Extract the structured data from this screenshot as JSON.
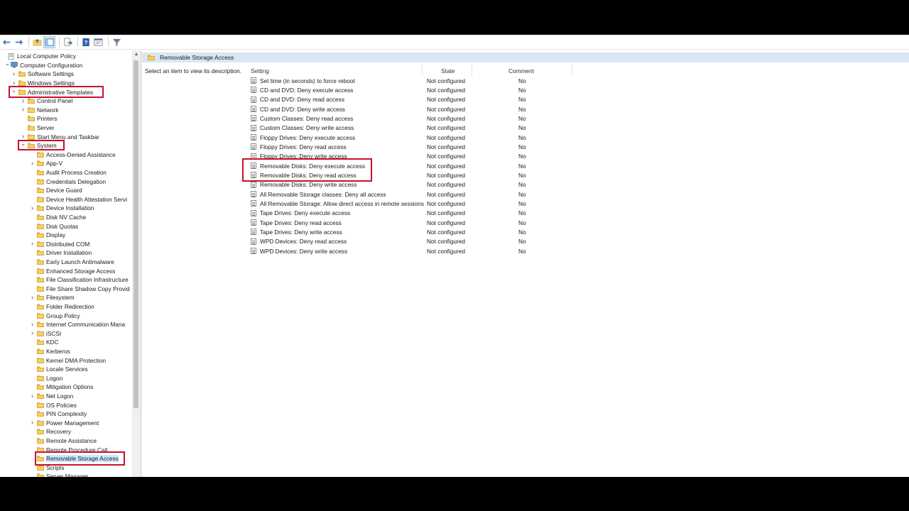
{
  "toolbar": {
    "buttons": [
      "back-icon",
      "forward-icon",
      "up-folder-icon",
      "show-hide-tree-icon",
      "export-list-icon",
      "help-icon",
      "properties-icon",
      "filter-icon"
    ]
  },
  "tree": {
    "items": [
      {
        "label": "Local Computer Policy",
        "level": 0,
        "twisty": ""
      },
      {
        "label": "Computer Configuration",
        "level": 1,
        "twisty": "v"
      },
      {
        "label": "Software Settings",
        "level": 2,
        "twisty": ">"
      },
      {
        "label": "Windows Settings",
        "level": 2,
        "twisty": ">"
      },
      {
        "label": "Administrative Templates",
        "level": 2,
        "twisty": "v"
      },
      {
        "label": "Control Panel",
        "level": 3,
        "twisty": ">"
      },
      {
        "label": "Network",
        "level": 3,
        "twisty": ">"
      },
      {
        "label": "Printers",
        "level": 3,
        "twisty": ""
      },
      {
        "label": "Server",
        "level": 3,
        "twisty": ""
      },
      {
        "label": "Start Menu and Taskbar",
        "level": 3,
        "twisty": ">"
      },
      {
        "label": "System",
        "level": 3,
        "twisty": "v"
      },
      {
        "label": "Access-Denied Assistance",
        "level": 4,
        "twisty": ""
      },
      {
        "label": "App-V",
        "level": 4,
        "twisty": ">"
      },
      {
        "label": "Audit Process Creation",
        "level": 4,
        "twisty": ""
      },
      {
        "label": "Credentials Delegation",
        "level": 4,
        "twisty": ""
      },
      {
        "label": "Device Guard",
        "level": 4,
        "twisty": ""
      },
      {
        "label": "Device Health Attestation Servi",
        "level": 4,
        "twisty": ""
      },
      {
        "label": "Device Installation",
        "level": 4,
        "twisty": ">"
      },
      {
        "label": "Disk NV Cache",
        "level": 4,
        "twisty": ""
      },
      {
        "label": "Disk Quotas",
        "level": 4,
        "twisty": ""
      },
      {
        "label": "Display",
        "level": 4,
        "twisty": ""
      },
      {
        "label": "Distributed COM",
        "level": 4,
        "twisty": ">"
      },
      {
        "label": "Driver Installation",
        "level": 4,
        "twisty": ""
      },
      {
        "label": "Early Launch Antimalware",
        "level": 4,
        "twisty": ""
      },
      {
        "label": "Enhanced Storage Access",
        "level": 4,
        "twisty": ""
      },
      {
        "label": "File Classification Infrastructure",
        "level": 4,
        "twisty": ""
      },
      {
        "label": "File Share Shadow Copy Provid",
        "level": 4,
        "twisty": ""
      },
      {
        "label": "Filesystem",
        "level": 4,
        "twisty": ">"
      },
      {
        "label": "Folder Redirection",
        "level": 4,
        "twisty": ""
      },
      {
        "label": "Group Policy",
        "level": 4,
        "twisty": ""
      },
      {
        "label": "Internet Communication Mana",
        "level": 4,
        "twisty": ">"
      },
      {
        "label": "iSCSI",
        "level": 4,
        "twisty": ">"
      },
      {
        "label": "KDC",
        "level": 4,
        "twisty": ""
      },
      {
        "label": "Kerberos",
        "level": 4,
        "twisty": ""
      },
      {
        "label": "Kernel DMA Protection",
        "level": 4,
        "twisty": ""
      },
      {
        "label": "Locale Services",
        "level": 4,
        "twisty": ""
      },
      {
        "label": "Logon",
        "level": 4,
        "twisty": ""
      },
      {
        "label": "Mitigation Options",
        "level": 4,
        "twisty": ""
      },
      {
        "label": "Net Logon",
        "level": 4,
        "twisty": ">"
      },
      {
        "label": "OS Policies",
        "level": 4,
        "twisty": ""
      },
      {
        "label": "PIN Complexity",
        "level": 4,
        "twisty": ""
      },
      {
        "label": "Power Management",
        "level": 4,
        "twisty": ">"
      },
      {
        "label": "Recovery",
        "level": 4,
        "twisty": ""
      },
      {
        "label": "Remote Assistance",
        "level": 4,
        "twisty": ""
      },
      {
        "label": "Remote Procedure Call",
        "level": 4,
        "twisty": ""
      },
      {
        "label": "Removable Storage Access",
        "level": 4,
        "twisty": "",
        "selected": true
      },
      {
        "label": "Scripts",
        "level": 4,
        "twisty": ""
      },
      {
        "label": "Server Manager",
        "level": 4,
        "twisty": ""
      }
    ]
  },
  "details": {
    "title": "Removable Storage Access",
    "description": "Select an item to view its description.",
    "columns": [
      "Setting",
      "State",
      "Comment"
    ],
    "rows": [
      {
        "setting": "Set time (in seconds) to force reboot",
        "state": "Not configured",
        "comment": "No"
      },
      {
        "setting": "CD and DVD: Deny execute access",
        "state": "Not configured",
        "comment": "No"
      },
      {
        "setting": "CD and DVD: Deny read access",
        "state": "Not configured",
        "comment": "No"
      },
      {
        "setting": "CD and DVD: Deny write access",
        "state": "Not configured",
        "comment": "No"
      },
      {
        "setting": "Custom Classes: Deny read access",
        "state": "Not configured",
        "comment": "No"
      },
      {
        "setting": "Custom Classes: Deny write access",
        "state": "Not configured",
        "comment": "No"
      },
      {
        "setting": "Floppy Drives: Deny execute access",
        "state": "Not configured",
        "comment": "No"
      },
      {
        "setting": "Floppy Drives: Deny read access",
        "state": "Not configured",
        "comment": "No"
      },
      {
        "setting": "Floppy Drives: Deny write access",
        "state": "Not configured",
        "comment": "No"
      },
      {
        "setting": "Removable Disks: Deny execute access",
        "state": "Not configured",
        "comment": "No"
      },
      {
        "setting": "Removable Disks: Deny read access",
        "state": "Not configured",
        "comment": "No"
      },
      {
        "setting": "Removable Disks: Deny write access",
        "state": "Not configured",
        "comment": "No"
      },
      {
        "setting": "All Removable Storage classes: Deny all access",
        "state": "Not configured",
        "comment": "No"
      },
      {
        "setting": "All Removable Storage: Allow direct access in remote sessions",
        "state": "Not configured",
        "comment": "No"
      },
      {
        "setting": "Tape Drives: Deny execute access",
        "state": "Not configured",
        "comment": "No"
      },
      {
        "setting": "Tape Drives: Deny read access",
        "state": "Not configured",
        "comment": "No"
      },
      {
        "setting": "Tape Drives: Deny write access",
        "state": "Not configured",
        "comment": "No"
      },
      {
        "setting": "WPD Devices: Deny read access",
        "state": "Not configured",
        "comment": "No"
      },
      {
        "setting": "WPD Devices: Deny write access",
        "state": "Not configured",
        "comment": "No"
      }
    ]
  },
  "highlight_color": "#c8102e"
}
